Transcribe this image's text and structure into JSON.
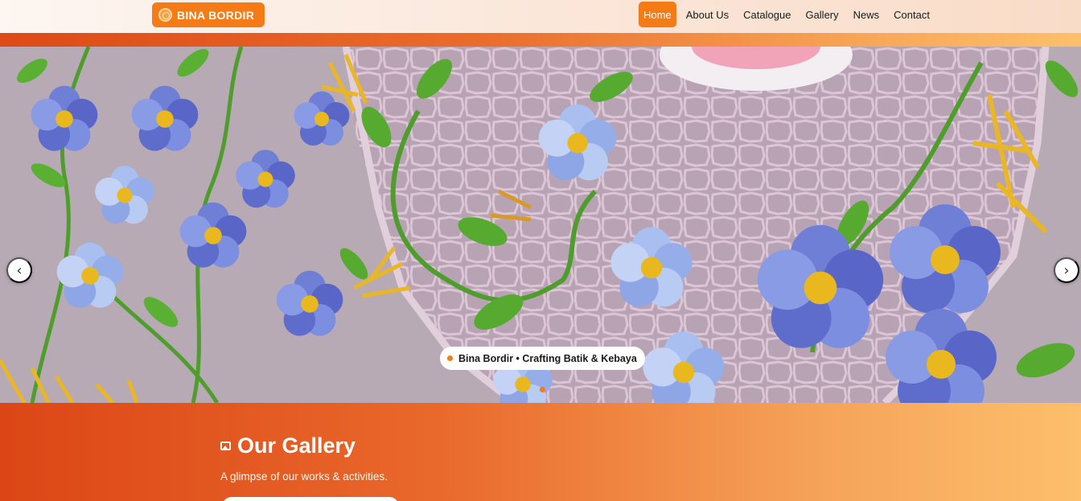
{
  "brand": {
    "name": "BINA BORDIR",
    "icon": "sun-logo-icon"
  },
  "nav": {
    "items": [
      {
        "label": "Home",
        "active": true
      },
      {
        "label": "About Us",
        "active": false
      },
      {
        "label": "Catalogue",
        "active": false
      },
      {
        "label": "Gallery",
        "active": false
      },
      {
        "label": "News",
        "active": false
      },
      {
        "label": "Contact",
        "active": false
      }
    ]
  },
  "hero": {
    "caption": "Bina Bordir • Crafting Batik & Kebaya",
    "prev_icon": "chevron-left-icon",
    "next_icon": "chevron-right-icon",
    "slide_index": 1,
    "slide_count": 1
  },
  "gallery": {
    "icon": "image-icon",
    "title": "Our Gallery",
    "subtitle": "A glimpse of our works & activities."
  },
  "colors": {
    "accent": "#f47b16",
    "gradient_start": "#dc4616",
    "gradient_end": "#fdbf6c",
    "fabric": "#b7a7b3"
  }
}
